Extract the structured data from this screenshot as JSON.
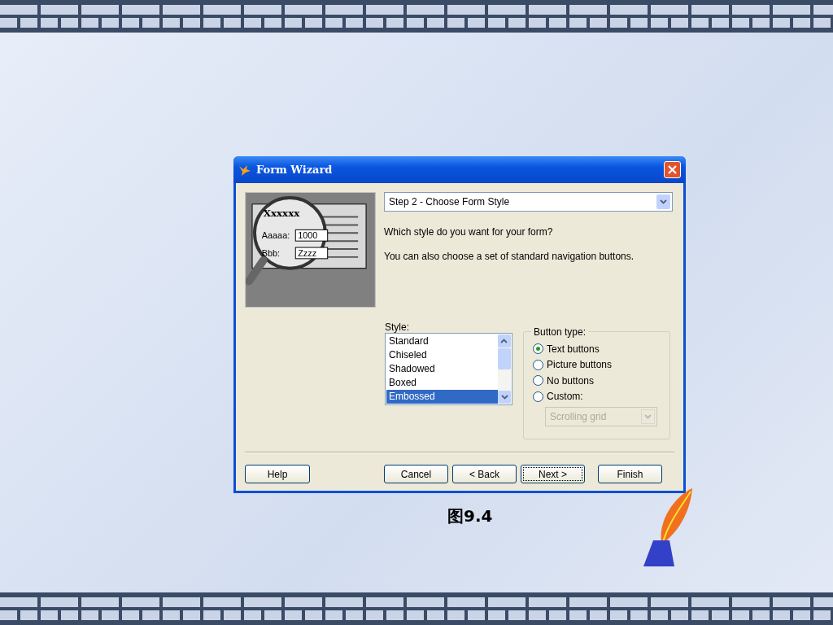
{
  "slide": {
    "caption": "图9.4"
  },
  "dialog": {
    "title": "Form Wizard",
    "preview": {
      "heading": "Xxxxxx",
      "fields": [
        {
          "label": "Aaaaa:",
          "value": "1000"
        },
        {
          "label": "Bbb:",
          "value": "Zzzz"
        }
      ]
    },
    "step": {
      "value": "Step 2 - Choose Form Style"
    },
    "prompts": [
      "Which style do you want for your form?",
      "You can also choose a set of standard navigation buttons."
    ],
    "style_list": {
      "label": "Style:",
      "items": [
        {
          "label": "Standard",
          "selected": false
        },
        {
          "label": "Chiseled",
          "selected": false
        },
        {
          "label": "Shadowed",
          "selected": false
        },
        {
          "label": "Boxed",
          "selected": false
        },
        {
          "label": "Embossed",
          "selected": true
        }
      ]
    },
    "button_type": {
      "label": "Button type:",
      "options": [
        {
          "label": "Text buttons",
          "selected": true
        },
        {
          "label": "Picture buttons",
          "selected": false
        },
        {
          "label": "No buttons",
          "selected": false
        },
        {
          "label": "Custom:",
          "selected": false
        }
      ],
      "custom_dropdown": {
        "value": "Scrolling grid",
        "disabled": true
      }
    },
    "help_button": {
      "label": "Help"
    },
    "buttons": [
      {
        "label": "Cancel",
        "focused": false
      },
      {
        "label": "< Back",
        "focused": false
      },
      {
        "label": "Next >",
        "focused": true
      },
      {
        "label": "Finish",
        "focused": false
      }
    ]
  }
}
